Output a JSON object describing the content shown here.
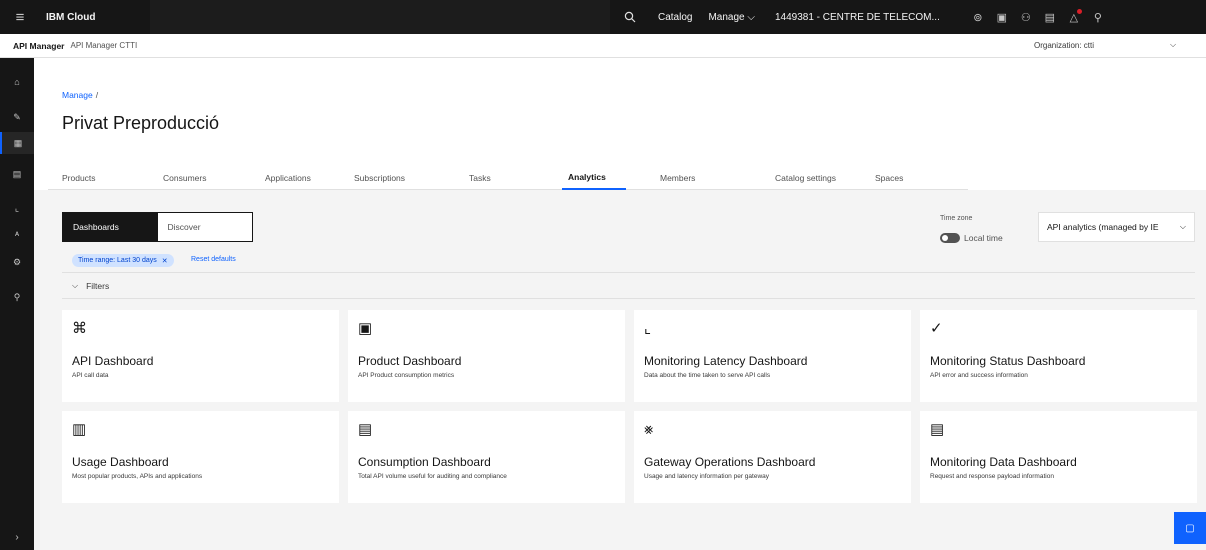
{
  "topbar": {
    "brand": "IBM Cloud",
    "nav": [
      "Catalog",
      "Manage ⌵"
    ],
    "account": "1449381 - CENTRE DE TELECOM...",
    "icons": [
      "help-icon",
      "cost-estimator-icon",
      "users-icon",
      "calendar-icon",
      "notification-icon",
      "user-avatar-icon"
    ]
  },
  "productbar": {
    "name": "API Manager",
    "subtitle": "API Manager CTTI",
    "organization": "Organization:  ctti"
  },
  "sidenav": {
    "items": [
      "home-icon",
      "edit-icon",
      "manage-icon",
      "catalog-icon",
      "analytics-icon",
      "members-icon",
      "settings-icon",
      "search-icon"
    ],
    "active_index": 2
  },
  "header": {
    "breadcrumb": "Manage",
    "breadcrumb_sep": "/",
    "title": "Privat Preproducció"
  },
  "tabs": [
    {
      "label": "Products"
    },
    {
      "label": "Consumers"
    },
    {
      "label": "Applications"
    },
    {
      "label": "Subscriptions"
    },
    {
      "label": "Tasks"
    },
    {
      "label": "Analytics"
    },
    {
      "label": "Members"
    },
    {
      "label": "Catalog settings"
    },
    {
      "label": "Spaces"
    }
  ],
  "active_tab": "Analytics",
  "switcher": {
    "on": "Dashboards",
    "off": "Discover"
  },
  "timezone": {
    "label": "Time zone",
    "value": "Local time"
  },
  "data_source": "API analytics (managed by IE",
  "filter_tag": "Time range: Last 30 days",
  "reset_label": "Reset defaults",
  "filters_label": "Filters",
  "tiles": [
    {
      "icon": "network-icon",
      "title": "API Dashboard",
      "desc": "API call data"
    },
    {
      "icon": "product-icon",
      "title": "Product Dashboard",
      "desc": "API Product consumption metrics"
    },
    {
      "icon": "latency-chart-icon",
      "title": "Monitoring Latency Dashboard",
      "desc": "Data about the time taken to serve API calls"
    },
    {
      "icon": "checkmark-icon",
      "title": "Monitoring Status Dashboard",
      "desc": "API error and success information"
    },
    {
      "icon": "bar-chart-icon",
      "title": "Usage Dashboard",
      "desc": "Most popular products, APIs and applications"
    },
    {
      "icon": "receipt-icon",
      "title": "Consumption Dashboard",
      "desc": "Total API volume useful for auditing and compliance"
    },
    {
      "icon": "gateway-icon",
      "title": "Gateway Operations Dashboard",
      "desc": "Usage and latency information per gateway"
    },
    {
      "icon": "data-table-icon",
      "title": "Monitoring Data Dashboard",
      "desc": "Request and response payload information"
    }
  ]
}
